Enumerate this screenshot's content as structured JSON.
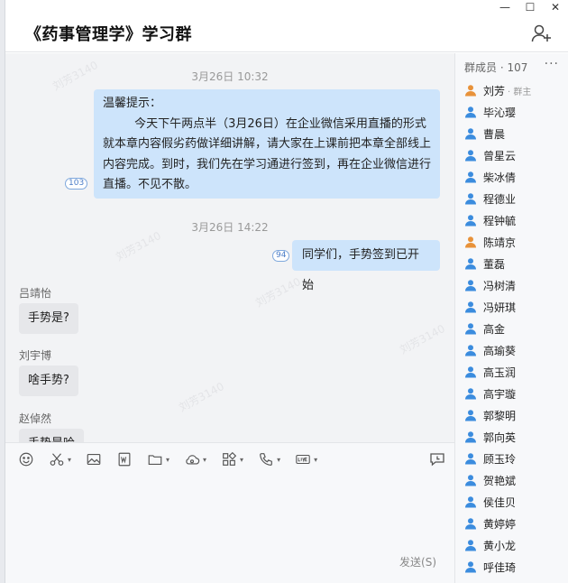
{
  "window": {
    "minimize": "—",
    "maximize": "☐",
    "close": "✕"
  },
  "header": {
    "title": "《药事管理学》学习群"
  },
  "watermark": "刘芳3140",
  "messages": {
    "t1": "3月26日 10:32",
    "notice_title": "温馨提示：",
    "notice_body": "今天下午两点半（3月26日）在企业微信采用直播的形式就本章内容假劣药做详细讲解，请大家在上课前把本章全部线上内容完成。到时，我们先在学习通进行签到，再在企业微信进行直播。不见不散。",
    "notice_read": "103",
    "t2": "3月26日 14:22",
    "m2_text": "同学们，手势签到已开始",
    "m2_read": "94",
    "m3_sender": "吕靖怡",
    "m3_text": "手势是?",
    "m4_sender": "刘宇博",
    "m4_text": "啥手势?",
    "m5_sender": "赵倬然",
    "m5_text": "手势是哈"
  },
  "members": {
    "header": "群成员 · 107",
    "more": "···",
    "owner_tag": "· 群主",
    "list": [
      {
        "name": "刘芳",
        "color": "#e8923a"
      },
      {
        "name": "毕沁璎",
        "color": "#3b8cde"
      },
      {
        "name": "曹晨",
        "color": "#3b8cde"
      },
      {
        "name": "曾星云",
        "color": "#3b8cde"
      },
      {
        "name": "柴冰倩",
        "color": "#3b8cde"
      },
      {
        "name": "程德业",
        "color": "#3b8cde"
      },
      {
        "name": "程钟毓",
        "color": "#3b8cde"
      },
      {
        "name": "陈靖京",
        "color": "#e8923a"
      },
      {
        "name": "董磊",
        "color": "#3b8cde"
      },
      {
        "name": "冯树清",
        "color": "#3b8cde"
      },
      {
        "name": "冯妍琪",
        "color": "#3b8cde"
      },
      {
        "name": "高金",
        "color": "#3b8cde"
      },
      {
        "name": "高瑜葵",
        "color": "#3b8cde"
      },
      {
        "name": "高玉润",
        "color": "#3b8cde"
      },
      {
        "name": "高宇璇",
        "color": "#3b8cde"
      },
      {
        "name": "郭黎明",
        "color": "#3b8cde"
      },
      {
        "name": "郭向英",
        "color": "#3b8cde"
      },
      {
        "name": "顾玉玲",
        "color": "#3b8cde"
      },
      {
        "name": "贺艳斌",
        "color": "#3b8cde"
      },
      {
        "name": "侯佳贝",
        "color": "#3b8cde"
      },
      {
        "name": "黄婷婷",
        "color": "#3b8cde"
      },
      {
        "name": "黄小龙",
        "color": "#3b8cde"
      },
      {
        "name": "呼佳琦",
        "color": "#3b8cde"
      }
    ]
  },
  "composer": {
    "send_label": "发送(S)"
  }
}
